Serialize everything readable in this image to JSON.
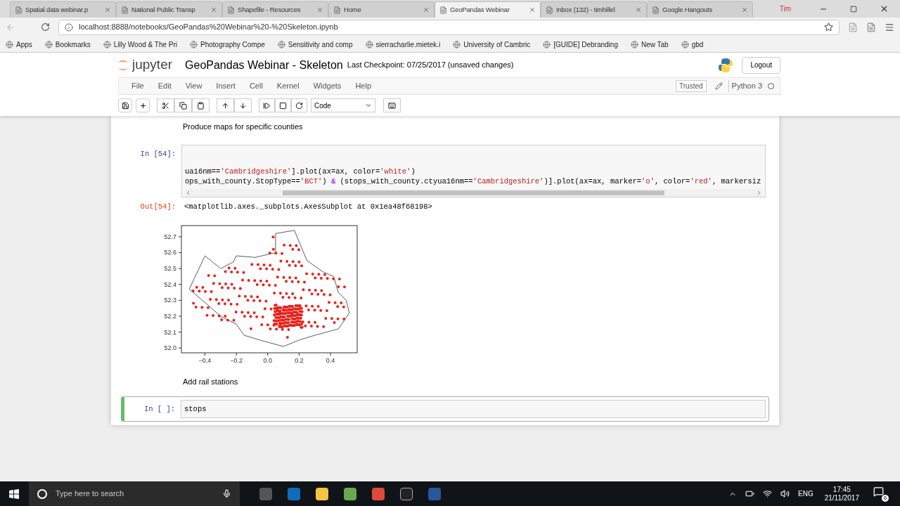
{
  "browser": {
    "tabs": [
      {
        "title": "Spatial data webinar.p",
        "selected": false
      },
      {
        "title": "National Public Transp",
        "selected": false
      },
      {
        "title": "Shapefile - Resources",
        "selected": false
      },
      {
        "title": "Home",
        "selected": false
      },
      {
        "title": "GeoPandas Webinar",
        "selected": true
      },
      {
        "title": "Inbox (132) - timhillel",
        "selected": false
      },
      {
        "title": "Google Hangouts",
        "selected": false
      }
    ],
    "profile": "Tim",
    "url": "localhost:8888/notebooks/GeoPandas%20Webinar%20-%20Skeleton.ipynb",
    "bookmarks": [
      "Apps",
      "Bookmarks",
      "Lilly Wood & The Pri",
      "Photography Compe",
      "Sensitivity and comp",
      "sierracharlie.mietek.i",
      "University of Cambric",
      "[GUIDE] Debranding",
      "New Tab",
      "gbd"
    ]
  },
  "jupyter": {
    "logo": "jupyter",
    "notebook_title": "GeoPandas Webinar - Skeleton",
    "checkpoint": "Last Checkpoint: 07/25/2017 (unsaved changes)",
    "logout": "Logout",
    "menu": [
      "File",
      "Edit",
      "View",
      "Insert",
      "Cell",
      "Kernel",
      "Widgets",
      "Help"
    ],
    "trusted": "Trusted",
    "kernel": "Python 3",
    "cell_type": "Code"
  },
  "cells": [
    {
      "kind": "markdown",
      "text": "Produce maps for specific counties"
    },
    {
      "kind": "code",
      "prompt": "In [54]:",
      "selected": false,
      "lines": [
        [
          {
            "kind": "plain",
            "text": "ua16nm=="
          },
          {
            "kind": "string",
            "text": "'Cambridgeshire'"
          },
          {
            "kind": "plain",
            "text": "].plot(ax=ax, color="
          },
          {
            "kind": "string",
            "text": "'white'"
          },
          {
            "kind": "plain",
            "text": ")"
          }
        ],
        [
          {
            "kind": "plain",
            "text": "ops_with_county.StopType=="
          },
          {
            "kind": "string",
            "text": "'BCT'"
          },
          {
            "kind": "plain",
            "text": ") "
          },
          {
            "kind": "operator",
            "text": "&"
          },
          {
            "kind": "plain",
            "text": " (stops_with_county.ctyua16nm=="
          },
          {
            "kind": "string",
            "text": "'Cambridgeshire'"
          },
          {
            "kind": "plain",
            "text": ")].plot(ax=ax, marker="
          },
          {
            "kind": "string",
            "text": "'o'"
          },
          {
            "kind": "plain",
            "text": ", color="
          },
          {
            "kind": "string",
            "text": "'red'"
          },
          {
            "kind": "plain",
            "text": ", markersiz"
          }
        ]
      ],
      "output_prompt": "Out[54]:",
      "output_text": "<matplotlib.axes._subplots.AxesSubplot at 0x1ea48f68198>",
      "map_plot": {
        "kind": "picture",
        "x_tick_labels": [
          "−0.4",
          "−0.2",
          "0.0",
          "0.2",
          "0.4"
        ],
        "y_tick_labels": [
          "52.7",
          "52.6",
          "52.5",
          "52.4",
          "52.3",
          "52.2",
          "52.1",
          "52.0"
        ]
      }
    },
    {
      "kind": "markdown",
      "text": "Add rail stations"
    },
    {
      "kind": "code",
      "prompt": "In [ ]:",
      "selected": true,
      "lines": [
        [
          {
            "kind": "plain",
            "text": "stops"
          }
        ]
      ]
    }
  ],
  "taskbar": {
    "search_placeholder": "Type here to search",
    "language": "ENG",
    "time": "17:45",
    "date": "21/11/2017",
    "notifications": "6"
  }
}
